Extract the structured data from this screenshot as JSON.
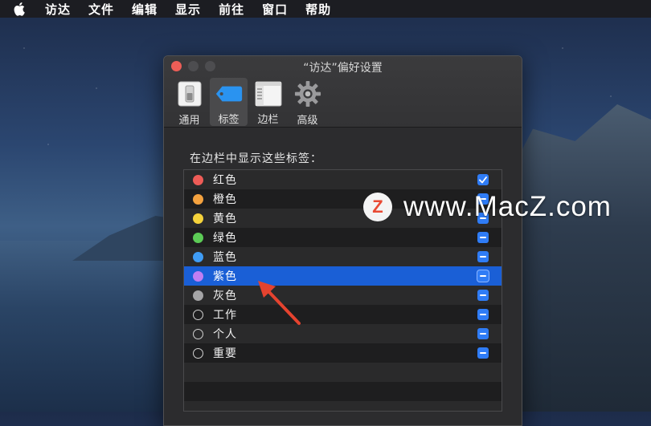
{
  "menubar": {
    "items": [
      "访达",
      "文件",
      "编辑",
      "显示",
      "前往",
      "窗口",
      "帮助"
    ]
  },
  "window": {
    "title": "“访达”偏好设置",
    "toolbar": [
      {
        "label": "通用",
        "icon": "general-switch-icon",
        "active": false
      },
      {
        "label": "标签",
        "icon": "tag-icon",
        "active": true
      },
      {
        "label": "边栏",
        "icon": "sidebar-icon",
        "active": false
      },
      {
        "label": "高级",
        "icon": "gear-icon",
        "active": false
      }
    ],
    "section_label": "在边栏中显示这些标签：",
    "tags": [
      {
        "label": "红色",
        "color": "#ee5c57",
        "hollow": false,
        "checked": true,
        "selected": false
      },
      {
        "label": "橙色",
        "color": "#f4a23f",
        "hollow": false,
        "checked": "mixed",
        "selected": false
      },
      {
        "label": "黄色",
        "color": "#f5d23b",
        "hollow": false,
        "checked": "mixed",
        "selected": false
      },
      {
        "label": "绿色",
        "color": "#5ccb56",
        "hollow": false,
        "checked": "mixed",
        "selected": false
      },
      {
        "label": "蓝色",
        "color": "#3f9cf5",
        "hollow": false,
        "checked": "mixed",
        "selected": false
      },
      {
        "label": "紫色",
        "color": "#c17ef2",
        "hollow": false,
        "checked": "mixed",
        "selected": true
      },
      {
        "label": "灰色",
        "color": "#a5a5a7",
        "hollow": false,
        "checked": "mixed",
        "selected": false
      },
      {
        "label": "工作",
        "color": "",
        "hollow": true,
        "checked": "mixed",
        "selected": false
      },
      {
        "label": "个人",
        "color": "",
        "hollow": true,
        "checked": "mixed",
        "selected": false
      },
      {
        "label": "重要",
        "color": "",
        "hollow": true,
        "checked": "mixed",
        "selected": false
      }
    ]
  },
  "watermark": {
    "logo": "Z",
    "text": "www.MacZ.com"
  },
  "colors": {
    "accent": "#2f7cf6",
    "selection": "#1a5fd6",
    "arrow": "#e5432f"
  }
}
